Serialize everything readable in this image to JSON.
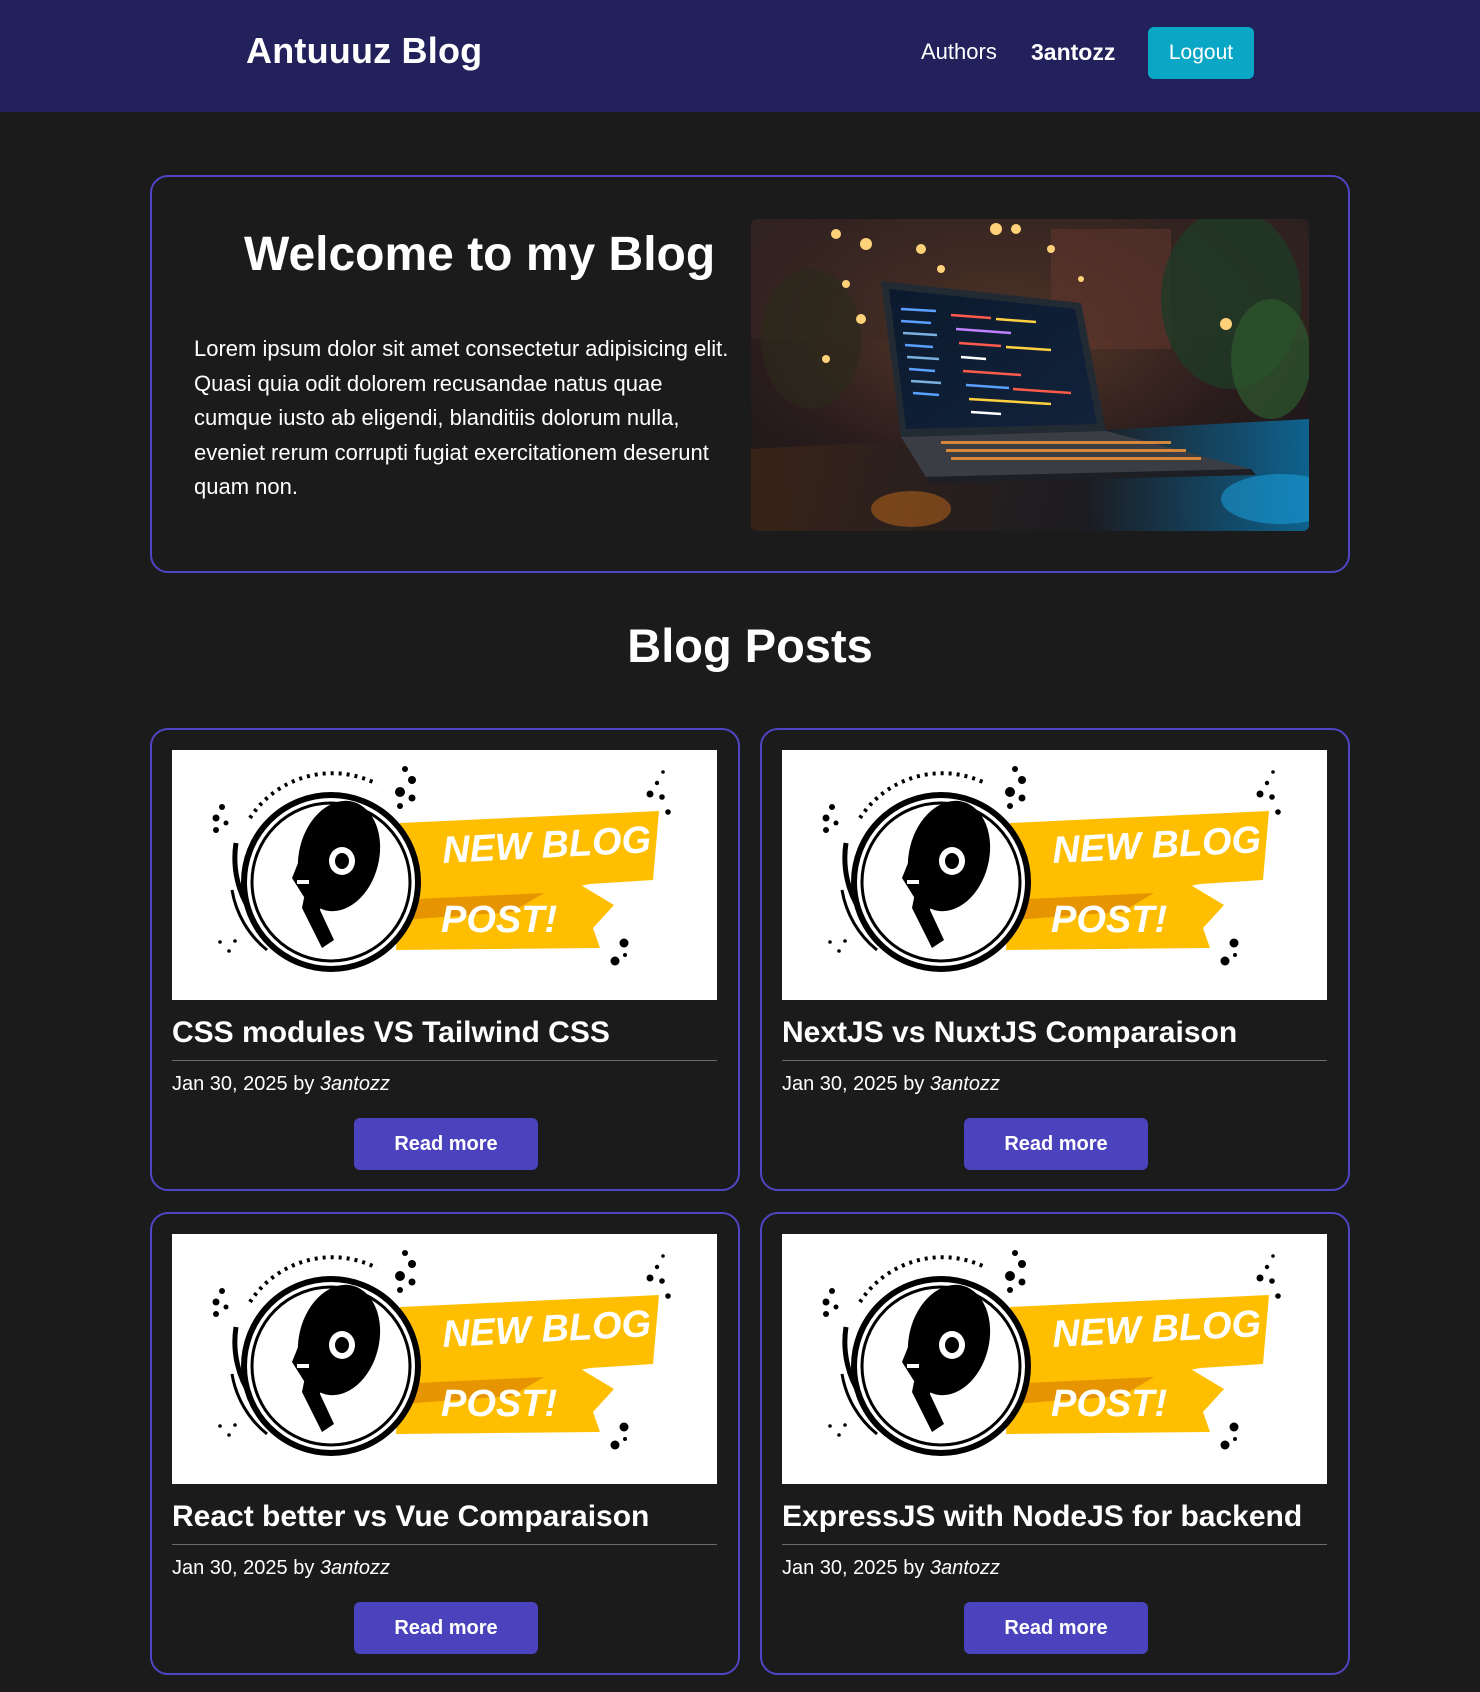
{
  "header": {
    "brand": "Antuuuz Blog",
    "nav_authors": "Authors",
    "nav_user": "3antozz",
    "logout_label": "Logout"
  },
  "hero": {
    "title": "Welcome to my Blog",
    "text": "Lorem ipsum dolor sit amet consectetur adipisicing elit. Quasi quia odit dolorem recusandae natus quae cumque iusto ab eligendi, blanditiis dolorum nulla, eveniet rerum corrupti fugiat exercitationem deserunt quam non."
  },
  "section_title": "Blog Posts",
  "post_image": {
    "line1": "NEW BLOG",
    "line2": "POST!"
  },
  "posts": [
    {
      "title": "CSS modules VS Tailwind CSS",
      "date": "Jan 30, 2025",
      "by": "by",
      "author": "3antozz",
      "cta": "Read more"
    },
    {
      "title": "NextJS vs NuxtJS Comparaison",
      "date": "Jan 30, 2025",
      "by": "by",
      "author": "3antozz",
      "cta": "Read more"
    },
    {
      "title": "React better vs Vue Comparaison",
      "date": "Jan 30, 2025",
      "by": "by",
      "author": "3antozz",
      "cta": "Read more"
    },
    {
      "title": "ExpressJS with NodeJS for backend",
      "date": "Jan 30, 2025",
      "by": "by",
      "author": "3antozz",
      "cta": "Read more"
    }
  ],
  "colors": {
    "navbar": "#22215b",
    "page_bg": "#1b1b1c",
    "accent_border": "#5045c4",
    "logout_button": "#0aa6c6",
    "read_more_button": "#4a43bd",
    "banner_yellow": "#ffbf00"
  }
}
